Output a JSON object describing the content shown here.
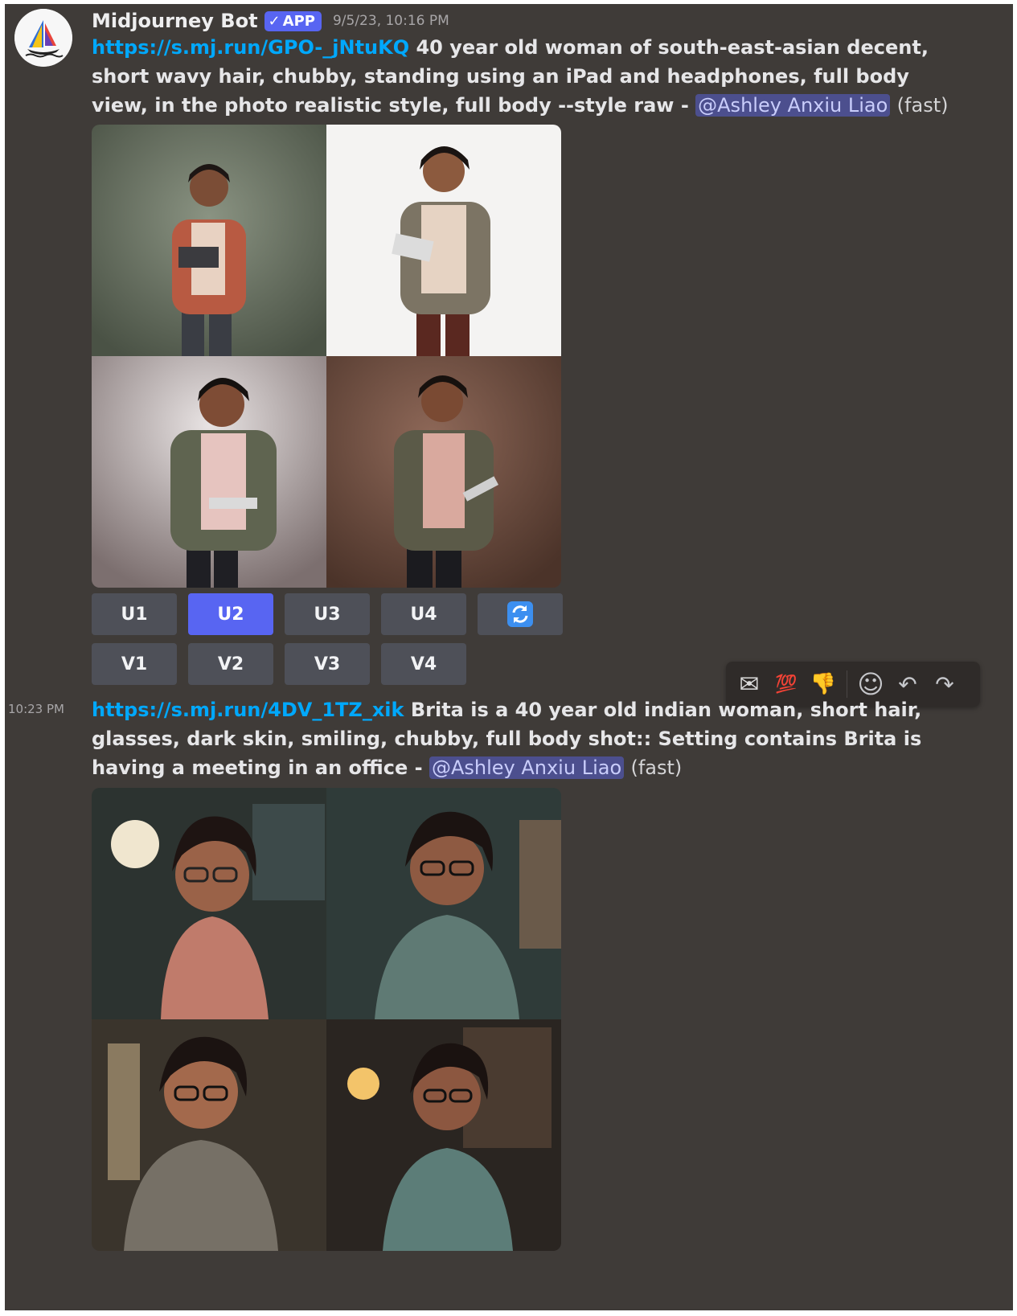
{
  "message1": {
    "author": "Midjourney Bot",
    "badge": "APP",
    "timestamp": "9/5/23, 10:16 PM",
    "link": "https://s.mj.run/GPO-_jNtuKQ",
    "prompt": " 40 year old woman of south-east-asian decent, short wavy hair, chubby, standing using an iPad and headphones, full body view, in the photo realistic style, full body --style raw - ",
    "mention": "@Ashley Anxiu Liao",
    "speed": "(fast)"
  },
  "buttons": {
    "row1": [
      "U1",
      "U2",
      "U3",
      "U4"
    ],
    "row2": [
      "V1",
      "V2",
      "V3",
      "V4"
    ],
    "active": "U2",
    "reroll_icon": "reroll-icon"
  },
  "toolbar": {
    "items": [
      "envelope-icon",
      "hundred-points-icon",
      "thumbs-down-icon",
      "add-reaction-icon",
      "reply-icon",
      "forward-icon"
    ],
    "glyphs": [
      "✉",
      "💯",
      "👎",
      "☺",
      "↶",
      "↷"
    ]
  },
  "message2": {
    "side_time": "10:23 PM",
    "link": "https://s.mj.run/4DV_1TZ_xik",
    "prompt": " Brita is a 40 year old indian woman, short hair, glasses, dark skin, smiling, chubby, full body shot:: Setting contains Brita is having a meeting in an office - ",
    "mention": "@Ashley Anxiu Liao",
    "speed": "(fast)"
  },
  "colors": {
    "background": "#3f3b38",
    "link": "#00a8fc",
    "button": "#4e5058",
    "button_active": "#5865f2",
    "mention_bg": "#4c4f8e"
  }
}
